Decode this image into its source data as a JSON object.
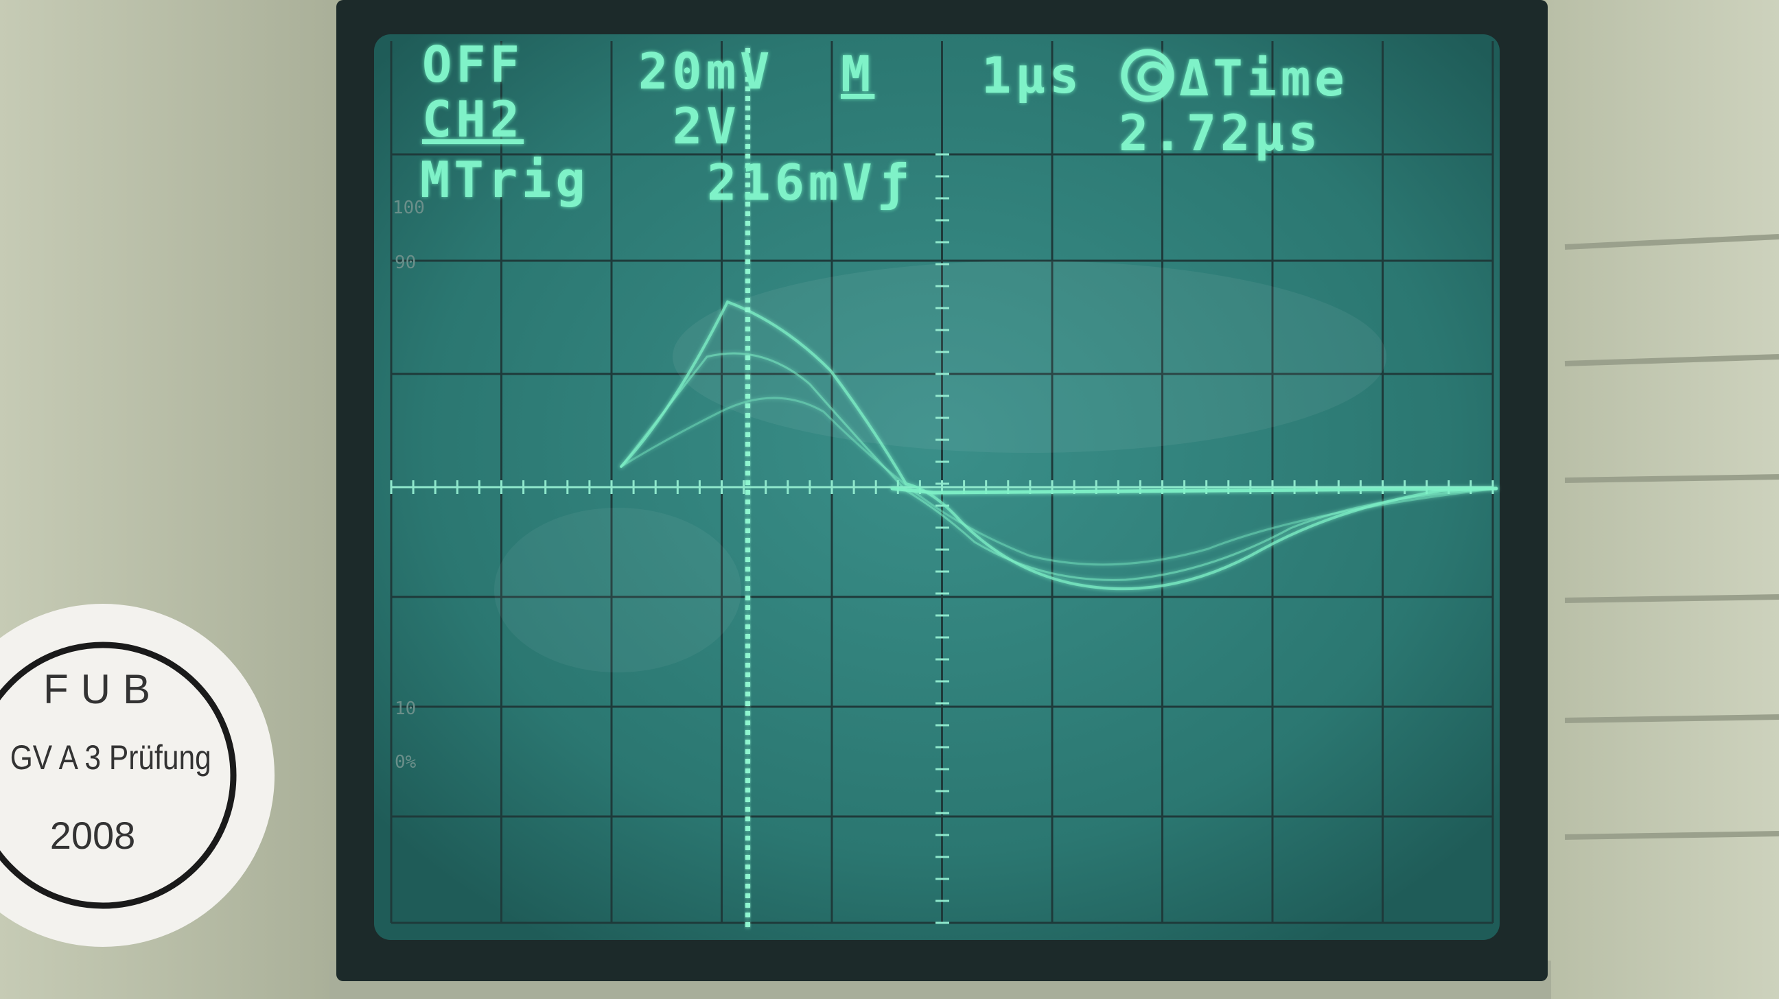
{
  "colors": {
    "phosphor": "#7ff2c8",
    "screen": "#2f7f7a",
    "bezel": "#1c2a2a",
    "panel": "#b9bfa8"
  },
  "readout": {
    "row1": {
      "mode": "OFF",
      "ch1_scale": "20mV",
      "timebase_icon": "M",
      "timebase": "1µs",
      "cursor_label": "ΔTime"
    },
    "row2": {
      "channel": "CH2",
      "ch2_scale": "2V",
      "delta_value": "2.72µs"
    },
    "row3": {
      "trigger_label": "MTrig",
      "trigger_level": "216mV",
      "trigger_slope": "ƒ"
    }
  },
  "graticule_labels": [
    "100",
    "90",
    "10",
    "0%"
  ],
  "sticker": {
    "line1": "FUB",
    "line2": "GV A 3 Prüfung",
    "line3": "2008"
  }
}
